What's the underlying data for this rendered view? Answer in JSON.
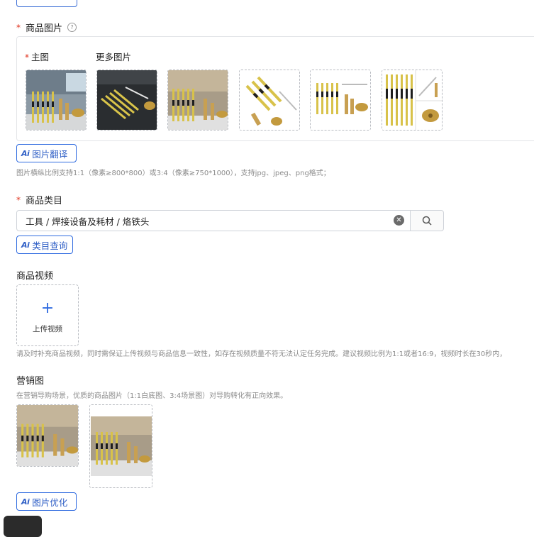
{
  "product_images": {
    "label": "商品图片",
    "help_icon": "?",
    "main_label": "主图",
    "more_label": "更多图片",
    "images": [
      {
        "name": "main-image",
        "alt": "solder tips on workbench"
      },
      {
        "name": "more-image-1",
        "alt": "solder tips on dark surface"
      },
      {
        "name": "more-image-2",
        "alt": "solder tips on workbench"
      },
      {
        "name": "more-image-3",
        "alt": "solder tips diagonal white"
      },
      {
        "name": "more-image-4",
        "alt": "solder tips white background"
      },
      {
        "name": "more-image-5",
        "alt": "solder tips collage"
      }
    ],
    "translate_button": "图片翻译",
    "hint": "图片横纵比例支持1:1（像素≥800*800）或3:4（像素≥750*1000），支持jpg、jpeg、png格式；"
  },
  "category": {
    "label": "商品类目",
    "value": "工具 / 焊接设备及耗材 / 烙铁头",
    "query_button": "类目查询"
  },
  "video": {
    "label": "商品视频",
    "upload_label": "上传视频",
    "hint": "请及时补充商品视频，同时需保证上传视频与商品信息一致性，如存在视频质量不符无法认定任务完成。建议视频比例为1:1或者16:9，视频时长在30秒内，"
  },
  "marketing": {
    "label": "营销图",
    "hint": "在营销导购场景，优质的商品图片（1:1白底图、3:4场景图）对导购转化有正向效果。",
    "optimize_button": "图片优化"
  },
  "ai_badge": "Ai",
  "colors": {
    "accent": "#2f6be0",
    "required": "#e0331e"
  }
}
